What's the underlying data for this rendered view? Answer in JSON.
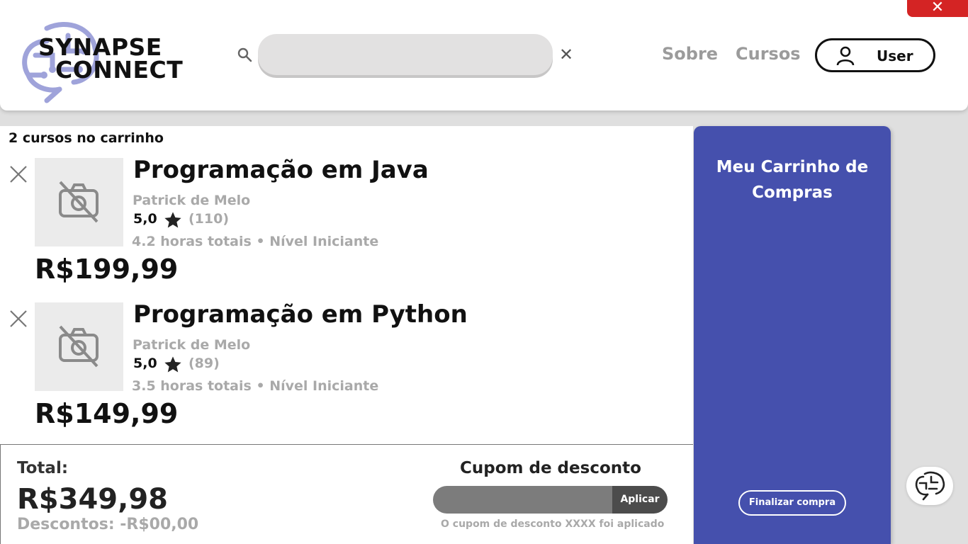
{
  "header": {
    "logo_line1": "SYNAPSE",
    "logo_line2": "CONNECT",
    "search": {
      "value": "",
      "placeholder": ""
    },
    "nav": {
      "sobre": "Sobre",
      "cursos": "Cursos"
    },
    "user_label": "User"
  },
  "cart": {
    "count_label": "2 cursos no carrinho",
    "items": [
      {
        "title": "Programação em Java",
        "author": "Patrick de Melo",
        "rating": "5,0",
        "reviews": "(110)",
        "meta": "4.2 horas totais • Nível Iniciante",
        "price": "R$199,99"
      },
      {
        "title": "Programação em Python",
        "author": "Patrick de Melo",
        "rating": "5,0",
        "reviews": "(89)",
        "meta": "3.5 horas totais • Nível Iniciante",
        "price": "R$149,99"
      }
    ]
  },
  "footer": {
    "total_label": "Total:",
    "total_value": "R$349,98",
    "discount": "Descontos: -R$00,00",
    "coupon_title": "Cupom de desconto",
    "coupon_value": "",
    "coupon_button": "Aplicar",
    "coupon_message": "O cupom de desconto XXXX foi aplicado"
  },
  "sidebar": {
    "title": "Meu Carrinho de Compras",
    "finalize_button": "Finalizar compra"
  },
  "colors": {
    "accent": "#4550ad",
    "close": "#d42424",
    "muted": "#a9a9a9"
  },
  "icons": [
    "close-icon",
    "brain-logo-icon",
    "search-icon",
    "clear-icon",
    "user-icon",
    "remove-icon",
    "no-camera-icon",
    "star-icon",
    "brain-chat-icon"
  ]
}
